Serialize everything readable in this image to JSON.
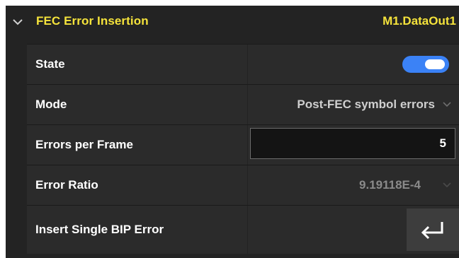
{
  "header": {
    "title": "FEC Error Insertion",
    "target": "M1.DataOut1",
    "expand_icon": "chevron-down-icon"
  },
  "rows": {
    "state": {
      "label": "State",
      "value": "on",
      "accent": "#3b82f6"
    },
    "mode": {
      "label": "Mode",
      "value": "Post-FEC symbol errors"
    },
    "errors_per_frame": {
      "label": "Errors per Frame",
      "value": "5"
    },
    "error_ratio": {
      "label": "Error Ratio",
      "value": "9.19118E-4"
    },
    "insert_bip": {
      "label": "Insert Single BIP Error",
      "button_icon": "enter-icon"
    }
  },
  "colors": {
    "title": "#f5e33b",
    "panel": "#232323",
    "cell": "#2b2b2b"
  }
}
